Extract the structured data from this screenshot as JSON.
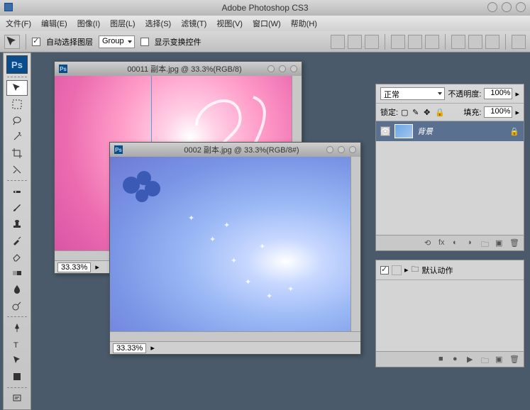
{
  "app": {
    "title": "Adobe Photoshop CS3",
    "logo": "Ps"
  },
  "menu": {
    "file": "文件(F)",
    "edit": "编辑(E)",
    "image": "图像(I)",
    "layer": "图层(L)",
    "select": "选择(S)",
    "filter": "滤镜(T)",
    "view": "视图(V)",
    "window": "窗口(W)",
    "help": "帮助(H)"
  },
  "options": {
    "auto_select_label": "自动选择图层",
    "group_label": "Group",
    "show_transform_label": "显示变换控件"
  },
  "docs": {
    "a": {
      "title": "00011 副本.jpg @ 33.3%(RGB/8)",
      "zoom": "33.33%"
    },
    "b": {
      "title": "0002 副本.jpg @ 33.3%(RGB/8#)",
      "zoom": "33.33%"
    }
  },
  "layers_panel": {
    "blend_mode": "正常",
    "opacity_label": "不透明度:",
    "opacity_value": "100%",
    "lock_label": "锁定:",
    "fill_label": "填充:",
    "fill_value": "100%",
    "layer_name": "背景"
  },
  "actions_panel": {
    "default_actions": "默认动作"
  }
}
